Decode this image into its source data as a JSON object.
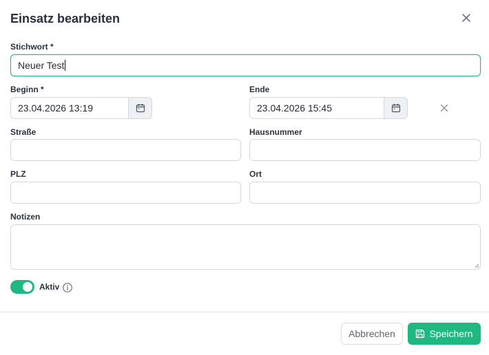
{
  "dialog": {
    "title": "Einsatz bearbeiten"
  },
  "form": {
    "stichwort": {
      "label": "Stichwort *",
      "value": "Neuer Test"
    },
    "beginn": {
      "label": "Beginn *",
      "value": "23.04.2026 13:19"
    },
    "ende": {
      "label": "Ende",
      "value": "23.04.2026 15:45"
    },
    "strasse": {
      "label": "Straße",
      "value": ""
    },
    "hausnummer": {
      "label": "Hausnummer",
      "value": ""
    },
    "plz": {
      "label": "PLZ",
      "value": ""
    },
    "ort": {
      "label": "Ort",
      "value": ""
    },
    "notizen": {
      "label": "Notizen",
      "value": ""
    },
    "aktiv": {
      "label": "Aktiv",
      "checked": true
    }
  },
  "footer": {
    "cancel_label": "Abbrechen",
    "save_label": "Speichern"
  },
  "colors": {
    "accent": "#1fb880",
    "focus_border": "#23b583",
    "border": "#d5d9df"
  },
  "icons": [
    "close-icon",
    "calendar-icon",
    "info-icon",
    "save-icon"
  ]
}
